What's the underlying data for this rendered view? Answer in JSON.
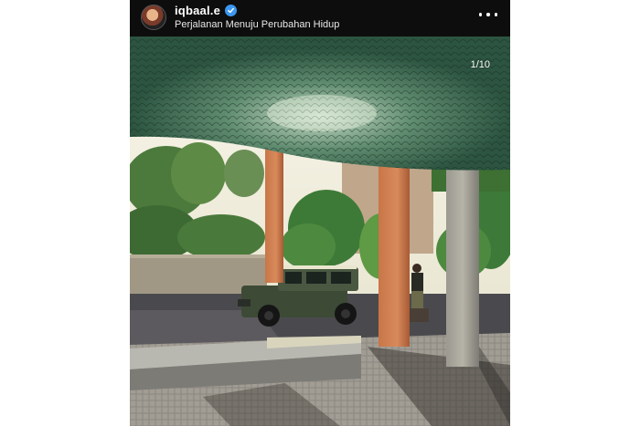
{
  "post": {
    "username": "iqbaal.e",
    "verified": true,
    "caption": "Perjalanan Menuju Perubahan Hidup",
    "counter": "1/10",
    "icons": {
      "avatar": "profile-avatar",
      "verified": "verified-badge-icon",
      "more": "more-options-icon"
    }
  },
  "colors": {
    "header_bg": "#0d0d0d",
    "verified_blue": "#3b97f0",
    "ceiling_green": "#2f5a44"
  }
}
